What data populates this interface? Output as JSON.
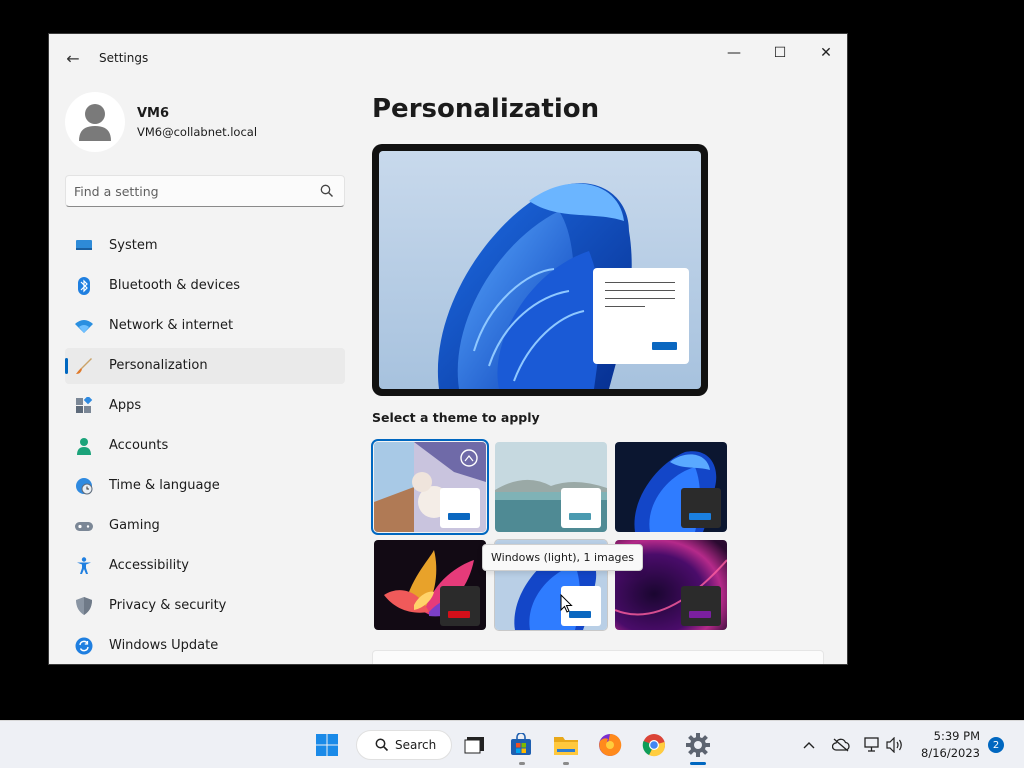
{
  "window": {
    "title": "Settings",
    "back": "←",
    "minimize": "—",
    "maximize": "☐",
    "close": "✕"
  },
  "profile": {
    "name": "VM6",
    "email": "VM6@collabnet.local"
  },
  "search": {
    "placeholder": "Find a setting"
  },
  "nav": {
    "items": [
      {
        "label": "System",
        "icon": "system-icon"
      },
      {
        "label": "Bluetooth & devices",
        "icon": "bluetooth-icon"
      },
      {
        "label": "Network & internet",
        "icon": "wifi-icon"
      },
      {
        "label": "Personalization",
        "icon": "brush-icon",
        "active": true
      },
      {
        "label": "Apps",
        "icon": "apps-icon"
      },
      {
        "label": "Accounts",
        "icon": "account-icon"
      },
      {
        "label": "Time & language",
        "icon": "globe-clock-icon"
      },
      {
        "label": "Gaming",
        "icon": "gamepad-icon"
      },
      {
        "label": "Accessibility",
        "icon": "accessibility-icon"
      },
      {
        "label": "Privacy & security",
        "icon": "shield-icon"
      },
      {
        "label": "Windows Update",
        "icon": "update-icon"
      }
    ]
  },
  "main": {
    "title": "Personalization",
    "themes_label": "Select a theme to apply",
    "tooltip": "Windows (light), 1 images"
  },
  "colors": {
    "accent": "#0067c0",
    "window_bg": "#f3f3f3"
  },
  "taskbar": {
    "search_label": "Search",
    "time": "5:39 PM",
    "date": "8/16/2023",
    "notifications": "2"
  }
}
